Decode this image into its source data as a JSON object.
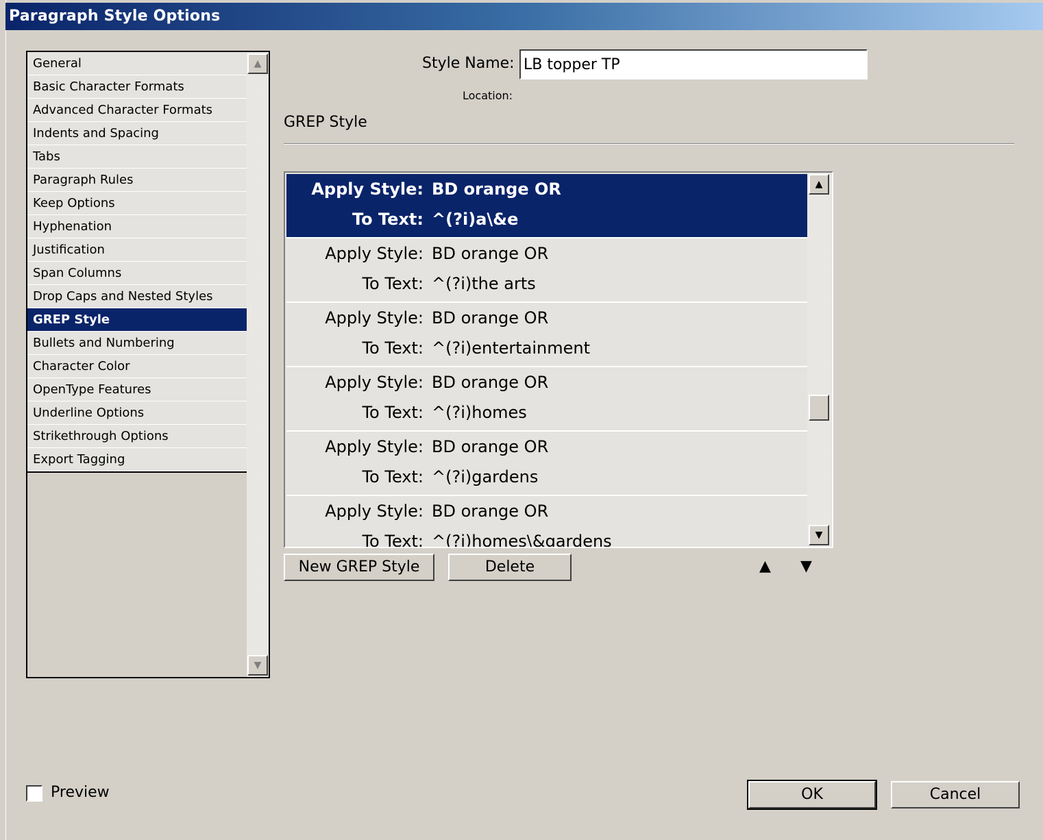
{
  "window": {
    "title": "Paragraph Style Options"
  },
  "categories": [
    {
      "label": "General",
      "selected": false
    },
    {
      "label": "Basic Character Formats",
      "selected": false
    },
    {
      "label": "Advanced Character Formats",
      "selected": false
    },
    {
      "label": "Indents and Spacing",
      "selected": false
    },
    {
      "label": "Tabs",
      "selected": false
    },
    {
      "label": "Paragraph Rules",
      "selected": false
    },
    {
      "label": "Keep Options",
      "selected": false
    },
    {
      "label": "Hyphenation",
      "selected": false
    },
    {
      "label": "Justification",
      "selected": false
    },
    {
      "label": "Span Columns",
      "selected": false
    },
    {
      "label": "Drop Caps and Nested Styles",
      "selected": false
    },
    {
      "label": "GREP Style",
      "selected": true
    },
    {
      "label": "Bullets and Numbering",
      "selected": false
    },
    {
      "label": "Character Color",
      "selected": false
    },
    {
      "label": "OpenType Features",
      "selected": false
    },
    {
      "label": "Underline Options",
      "selected": false
    },
    {
      "label": "Strikethrough Options",
      "selected": false
    },
    {
      "label": "Export Tagging",
      "selected": false
    }
  ],
  "style_name": {
    "label": "Style Name:",
    "value": "LB topper TP"
  },
  "location": {
    "label": "Location:"
  },
  "section_title": "GREP Style",
  "grep_rules": [
    {
      "apply_label": "Apply Style:",
      "style": "BD orange OR",
      "text_label": "To Text:",
      "text": "^(?i)a\\&e",
      "selected": true
    },
    {
      "apply_label": "Apply Style:",
      "style": "BD orange OR",
      "text_label": "To Text:",
      "text": "^(?i)the arts",
      "selected": false
    },
    {
      "apply_label": "Apply Style:",
      "style": "BD orange OR",
      "text_label": "To Text:",
      "text": "^(?i)entertainment",
      "selected": false
    },
    {
      "apply_label": "Apply Style:",
      "style": "BD orange OR",
      "text_label": "To Text:",
      "text": "^(?i)homes",
      "selected": false
    },
    {
      "apply_label": "Apply Style:",
      "style": "BD orange OR",
      "text_label": "To Text:",
      "text": "^(?i)gardens",
      "selected": false
    },
    {
      "apply_label": "Apply Style:",
      "style": "BD orange OR",
      "text_label": "To Text:",
      "text": "^(?i)homes\\&gardens",
      "selected": false
    }
  ],
  "buttons": {
    "new_grep": "New GREP Style",
    "delete": "Delete",
    "ok": "OK",
    "cancel": "Cancel"
  },
  "preview": {
    "label": "Preview",
    "checked": false
  },
  "icons": {
    "scroll_up": "scroll-up-arrow-icon",
    "scroll_down": "scroll-down-arrow-icon",
    "move_up": "move-up-triangle-icon",
    "move_down": "move-down-triangle-icon"
  },
  "colors": {
    "selection": "#0a246a",
    "dialog_bg": "#d4d0c8"
  }
}
